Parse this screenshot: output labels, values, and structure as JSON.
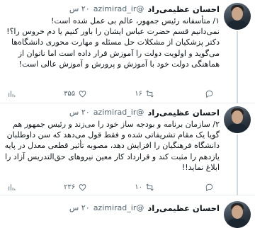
{
  "tweets": [
    {
      "name": "احسان عظیمی‌راد",
      "handle": "@azimirad_ir",
      "time": "۲۰ س",
      "lines": [
        "۱/ متأسفانه رئیس جمهور، عالم بی عمل شده است!",
        "نمی‌دانیم قسم حضرت عباس ایشان را باور کنیم یا دم خروس را؟!",
        "دکتر پزشکیان از مشکلات حل مسئله و مهارت محوری دانشگاه‌ها",
        "می‌گوید و اولویت دولت را آموزش قرار داده است اما ناتوان از",
        "هماهنگی دولت خود با آموزش و پرورش و آموزش عالی است!"
      ],
      "replies": "",
      "retweets": "۱۶",
      "likes": "۳۵۵",
      "views": ""
    },
    {
      "name": "احسان عظیمی‌راد",
      "handle": "@azimirad_ir",
      "time": "۲۰ س",
      "lines": [
        "۲/ سازمان برنامه و بودجه ساز خود را می‌زند و رئیس جمهور هم",
        "گویا یک مقام تشریفاتی شده و فقط قول می‌دهد که سن داوطلبان",
        "دانشگاه فرهنگیان را افزایش دهد، مصوبه تأثیر قطعی معدل در پایه",
        "یازدهم را مثبت کند و قرارداد کار معین نیروهای حق‌التدریس آزاد را",
        "ابلاغ نماید!!"
      ],
      "replies": "",
      "retweets": "۱۰",
      "likes": "۲۳۶",
      "views": ""
    },
    {
      "name": "احسان عظیمی‌راد",
      "handle": "@azimirad_ir",
      "time": "۲۰ س"
    }
  ]
}
